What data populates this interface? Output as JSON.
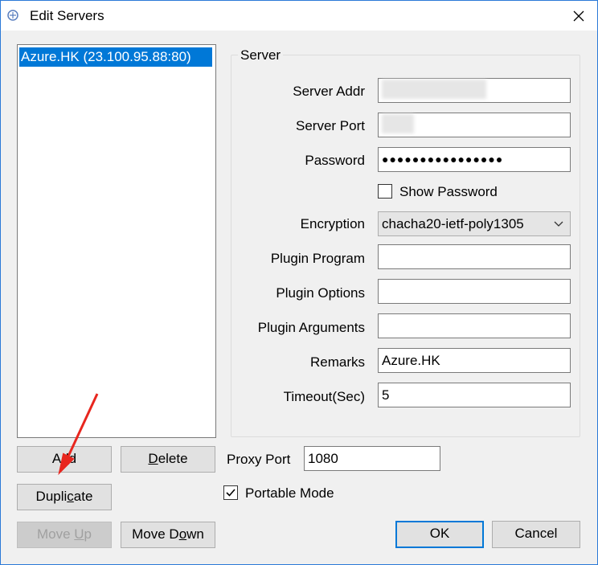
{
  "window": {
    "title": "Edit Servers"
  },
  "servers": [
    "Azure.HK (23.100.95.88:80)"
  ],
  "server_group": {
    "title": "Server",
    "server_addr": {
      "label": "Server Addr",
      "value": ""
    },
    "server_port": {
      "label": "Server Port",
      "value": ""
    },
    "password": {
      "label": "Password",
      "value": "●●●●●●●●●●●●●●●●"
    },
    "show_password": {
      "label": "Show Password",
      "checked": false
    },
    "encryption": {
      "label": "Encryption",
      "value": "chacha20-ietf-poly1305"
    },
    "plugin_program": {
      "label": "Plugin Program",
      "value": ""
    },
    "plugin_options": {
      "label": "Plugin Options",
      "value": ""
    },
    "plugin_arguments": {
      "label": "Plugin Arguments",
      "value": ""
    },
    "remarks": {
      "label": "Remarks",
      "value": "Azure.HK"
    },
    "timeout": {
      "label": "Timeout(Sec)",
      "value": "5"
    }
  },
  "proxy_port": {
    "label": "Proxy Port",
    "value": "1080"
  },
  "portable_mode": {
    "label": "Portable Mode",
    "checked": true
  },
  "buttons": {
    "add": {
      "pre": "A",
      "mn": "d",
      "post": "d"
    },
    "delete": {
      "pre": "",
      "mn": "D",
      "post": "elete"
    },
    "duplicate": {
      "pre": "Dupli",
      "mn": "c",
      "post": "ate"
    },
    "move_up": {
      "pre": "Move ",
      "mn": "U",
      "post": "p"
    },
    "move_down": {
      "pre": "Move D",
      "mn": "o",
      "post": "wn"
    },
    "ok": "OK",
    "cancel": "Cancel"
  },
  "colors": {
    "selection": "#0078d7",
    "annotation_arrow": "#e8261e"
  },
  "icons": {
    "close": "close-icon",
    "app": "app-icon",
    "dropdown": "chevron-down-icon",
    "check": "check-icon"
  }
}
